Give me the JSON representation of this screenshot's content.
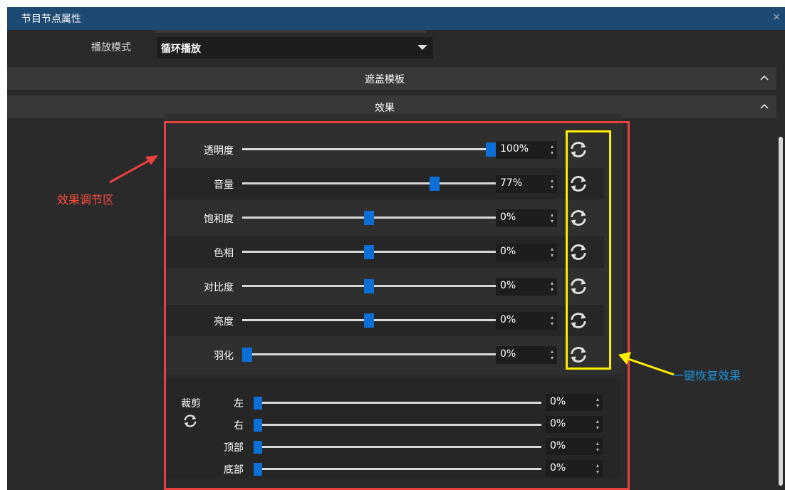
{
  "window": {
    "title": "节目节点属性",
    "close_label": "×"
  },
  "playback": {
    "label": "播放模式",
    "value": "循环播放"
  },
  "sections": {
    "mask": "遮盖模板",
    "effects": "效果"
  },
  "effects": [
    {
      "label": "透明度",
      "value": "100%",
      "level": 1.0
    },
    {
      "label": "音量",
      "value": "77%",
      "level": 0.77
    },
    {
      "label": "饱和度",
      "value": "0%",
      "level": 0.5
    },
    {
      "label": "色相",
      "value": "0%",
      "level": 0.5
    },
    {
      "label": "对比度",
      "value": "0%",
      "level": 0.5
    },
    {
      "label": "亮度",
      "value": "0%",
      "level": 0.5
    },
    {
      "label": "羽化",
      "value": "0%",
      "level": 0.0
    }
  ],
  "crop": {
    "title": "裁剪",
    "items": [
      {
        "label": "左",
        "value": "0%",
        "level": 0.0
      },
      {
        "label": "右",
        "value": "0%",
        "level": 0.0
      },
      {
        "label": "顶部",
        "value": "0%",
        "level": 0.0
      },
      {
        "label": "底部",
        "value": "0%",
        "level": 0.0
      }
    ]
  },
  "annotations": {
    "effects_area": "效果调节区",
    "reset_all": "一键恢复效果"
  },
  "colors": {
    "titlebar": "#1c4a73",
    "slider_thumb": "#0b6fd6",
    "highlight_red": "#e8403d",
    "highlight_yellow": "#ffee00",
    "annotation_blue": "#1e8fd9"
  },
  "icons": {
    "reset": "refresh-icon",
    "collapse": "chevron-up-icon"
  }
}
